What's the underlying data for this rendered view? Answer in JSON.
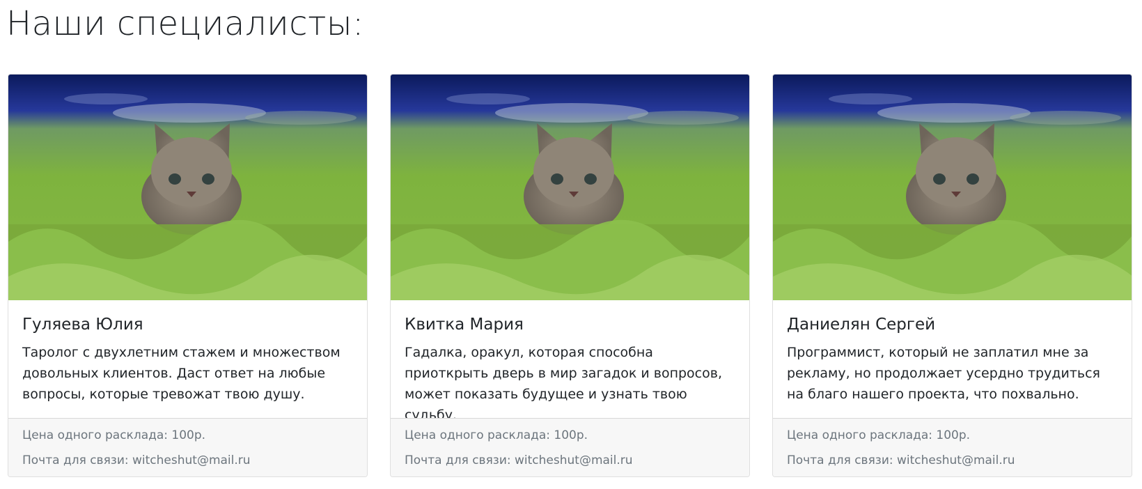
{
  "page": {
    "title": "Наши специалисты:"
  },
  "cards": [
    {
      "name": "Гуляева Юлия",
      "description": "Таролог с двухлетним стажем и множеством довольных клиентов. Даст ответ на любые вопросы, которые тревожат твою душу.",
      "price": "Цена одного расклада: 100р.",
      "contact": "Почта для связи: witcheshut@mail.ru",
      "image": "kitten-in-grass-photo"
    },
    {
      "name": "Квитка Мария",
      "description": "Гадалка, оракул, которая способна приоткрыть дверь в мир загадок и вопросов, может показать будущее и узнать твою судьбу.",
      "price": "Цена одного расклада: 100р.",
      "contact": "Почта для связи: witcheshut@mail.ru",
      "image": "kitten-in-grass-photo"
    },
    {
      "name": "Даниелян Сергей",
      "description": "Программист, который не заплатил мне за рекламу, но продолжает усердно трудиться на благо нашего проекта, что похвально.",
      "price": "Цена одного расклада: 100р.",
      "contact": "Почта для связи: witcheshut@mail.ru",
      "image": "kitten-in-grass-photo"
    }
  ]
}
